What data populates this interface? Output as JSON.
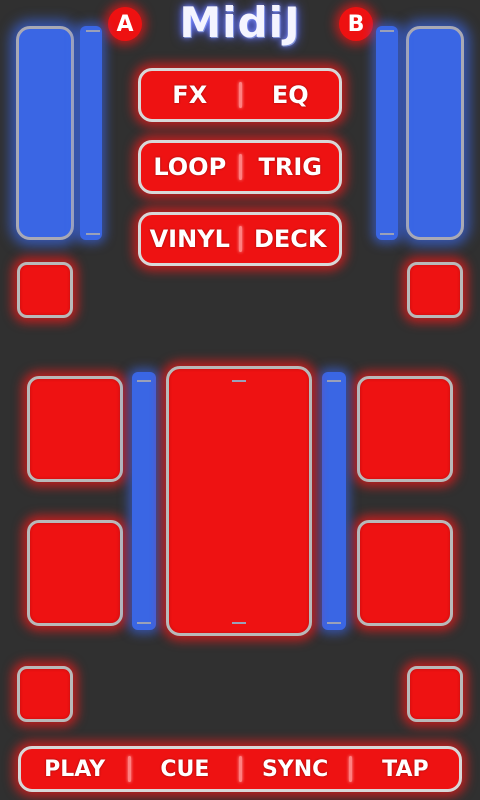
{
  "app": {
    "title": "MidiJ"
  },
  "decks": {
    "left_label": "A",
    "right_label": "B"
  },
  "mode_buttons": [
    {
      "left": "FX",
      "right": "EQ"
    },
    {
      "left": "LOOP",
      "right": "TRIG"
    },
    {
      "left": "VINYL",
      "right": "DECK"
    }
  ],
  "transport": {
    "play": "PLAY",
    "cue": "CUE",
    "sync": "SYNC",
    "tap": "TAP"
  },
  "colors": {
    "background": "#303030",
    "pad": "#ee1212",
    "slider": "#3a66e4",
    "border": "#b9b9b9"
  }
}
